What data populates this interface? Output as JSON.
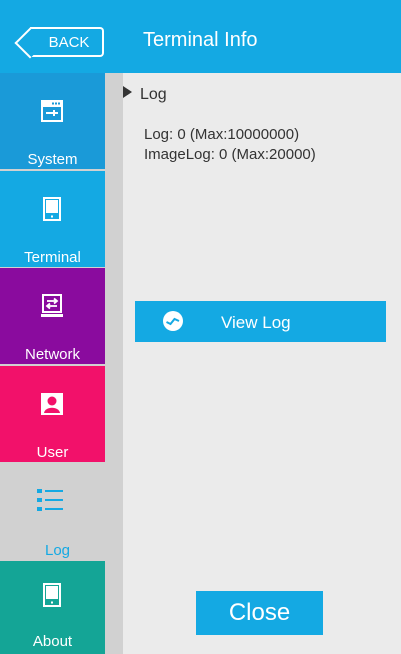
{
  "header": {
    "back_label": "BACK",
    "title": "Terminal Info"
  },
  "sidebar": {
    "items": [
      {
        "label": "System",
        "icon": "system-icon"
      },
      {
        "label": "Terminal",
        "icon": "terminal-icon"
      },
      {
        "label": "Network",
        "icon": "network-icon"
      },
      {
        "label": "User",
        "icon": "user-icon"
      },
      {
        "label": "Log",
        "icon": "log-list-icon",
        "selected": true
      },
      {
        "label": "About",
        "icon": "about-icon"
      }
    ]
  },
  "main": {
    "section_title": "Log",
    "lines": [
      "Log: 0 (Max:10000000)",
      "ImageLog: 0 (Max:20000)"
    ],
    "view_log_label": "View Log",
    "close_label": "Close"
  },
  "colors": {
    "accent": "#14a9e3",
    "network": "#8a0b9e",
    "user": "#f2116a",
    "about": "#14a596"
  }
}
